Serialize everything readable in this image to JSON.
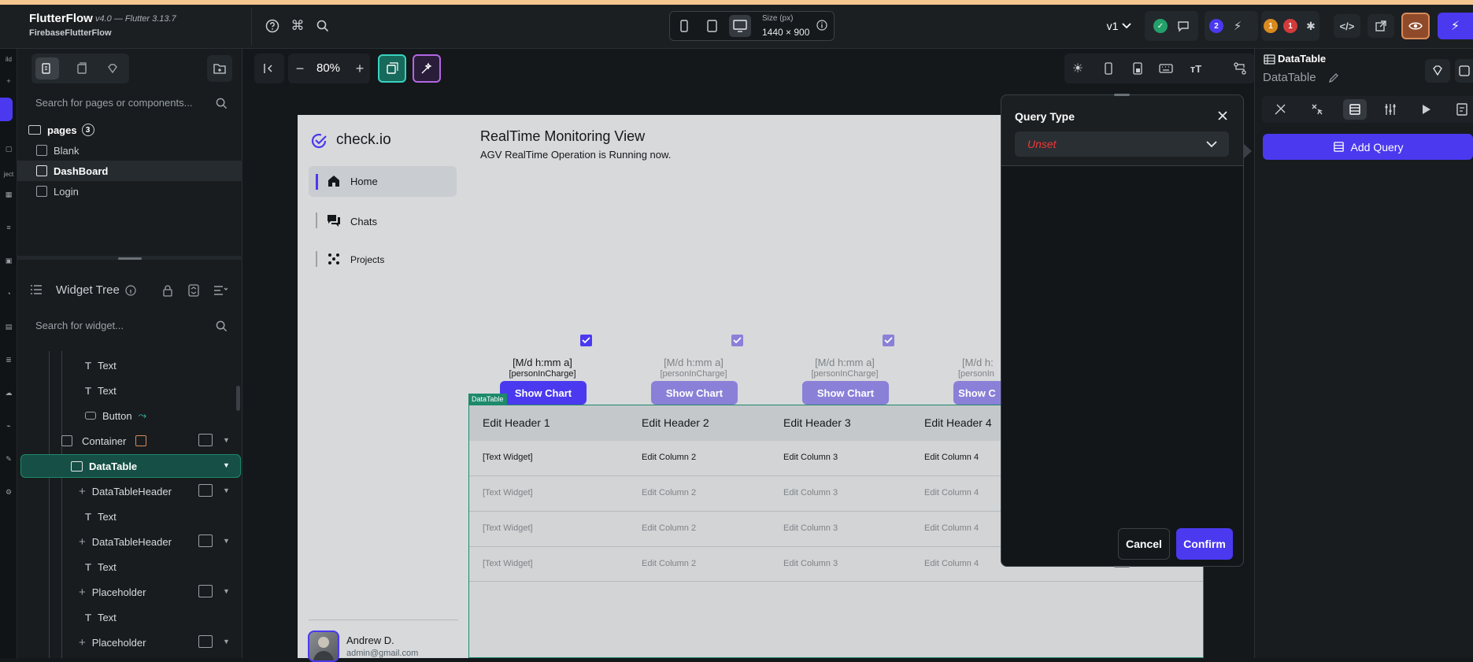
{
  "app": {
    "name": "FlutterFlow",
    "version": "v4.0 — Flutter 3.13.7",
    "project": "FirebaseFlutterFlow"
  },
  "topbar": {
    "size_label": "Size (px)",
    "size_value": "1440 × 900",
    "version_select": "v1",
    "badge_blue": "2",
    "badge_orange": "1",
    "badge_red": "1"
  },
  "left_strip": {
    "label_a": "ild",
    "label_b": "ject"
  },
  "pages_panel": {
    "search_placeholder": "Search for pages or components...",
    "folder_label": "pages",
    "folder_count": "3",
    "items": [
      "Blank",
      "DashBoard",
      "Login"
    ]
  },
  "widget_tree": {
    "title": "Widget Tree",
    "search_placeholder": "Search for widget...",
    "nodes": [
      {
        "label": "Text"
      },
      {
        "label": "Text"
      },
      {
        "label": "Button"
      },
      {
        "label": "Container"
      },
      {
        "label": "DataTable"
      },
      {
        "label": "DataTableHeader"
      },
      {
        "label": "Text"
      },
      {
        "label": "DataTableHeader"
      },
      {
        "label": "Text"
      },
      {
        "label": "Placeholder"
      },
      {
        "label": "Text"
      },
      {
        "label": "Placeholder"
      }
    ]
  },
  "canvas": {
    "zoom": "80%"
  },
  "preview": {
    "brand": "check.io",
    "nav": [
      "Home",
      "Chats",
      "Projects"
    ],
    "title": "RealTime Monitoring View",
    "subtitle": "AGV RealTime Operation is Running now.",
    "cards": [
      {
        "time": "[M/d h:mm a]",
        "person": "[personInCharge]",
        "button": "Show Chart"
      },
      {
        "time": "[M/d h:mm a]",
        "person": "[personInCharge]",
        "button": "Show Chart"
      },
      {
        "time": "[M/d h:mm a]",
        "person": "[personInCharge]",
        "button": "Show Chart"
      },
      {
        "time": "[M/d h:",
        "person": "[personIn",
        "button": "Show C"
      }
    ],
    "datatable": {
      "tag": "DataTable",
      "headers": [
        "Edit Header 1",
        "Edit Header 2",
        "Edit Header 3",
        "Edit Header 4"
      ],
      "rows": [
        [
          "[Text Widget]",
          "Edit Column 2",
          "Edit Column 3",
          "Edit Column 4"
        ],
        [
          "[Text Widget]",
          "Edit Column 2",
          "Edit Column 3",
          "Edit Column 4"
        ],
        [
          "[Text Widget]",
          "Edit Column 2",
          "Edit Column 3",
          "Edit Column 4"
        ],
        [
          "[Text Widget]",
          "Edit Column 2",
          "Edit Column 3",
          "Edit Column 4"
        ]
      ]
    },
    "user": {
      "name": "Andrew D.",
      "email": "admin@gmail.com"
    }
  },
  "query_modal": {
    "title": "Query Type",
    "value": "Unset",
    "cancel": "Cancel",
    "confirm": "Confirm"
  },
  "right_panel": {
    "title": "DataTable",
    "subtitle": "DataTable",
    "add_query": "Add Query"
  },
  "colors": {
    "accent": "#4b39ef",
    "error": "#ef3939",
    "success": "#1d8a6b"
  }
}
